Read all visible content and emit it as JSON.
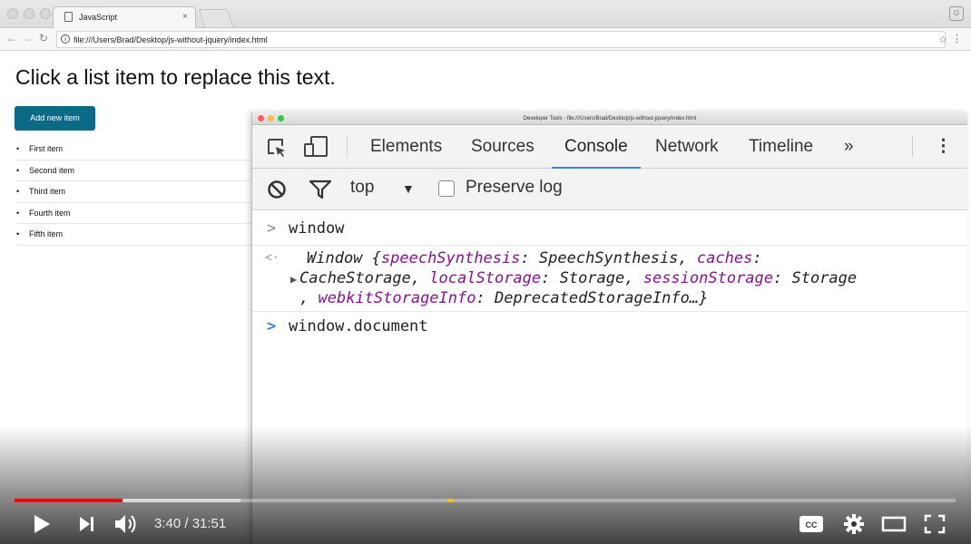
{
  "browser": {
    "tab_title": "JavaScript",
    "tab_close": "×",
    "url": "file:///Users/Brad/Desktop/js-without-jquery/index.html"
  },
  "page": {
    "heading": "Click a list item to replace this text.",
    "add_button": "Add new item",
    "items": [
      "First item",
      "Second item",
      "Third item",
      "Fourth item",
      "Fifth item"
    ]
  },
  "devtools": {
    "window_title": "Developer Tools - file:///Users/Brad/Desktop/js-without-jquery/index.html",
    "tabs": [
      "Elements",
      "Sources",
      "Console",
      "Network",
      "Timeline"
    ],
    "active_tab": "Console",
    "more_tabs": "»",
    "context": "top",
    "preserve_log": "Preserve log",
    "console": {
      "input1": "window",
      "output1": {
        "line1_a": "Window {",
        "line1_b": "speechSynthesis",
        "line1_c": ": SpeechSynthesis, ",
        "line1_d": "caches",
        "line1_e": ":",
        "line2_a": "CacheStorage, ",
        "line2_b": "localStorage",
        "line2_c": ": Storage, ",
        "line2_d": "sessionStorage",
        "line2_e": ": Storage",
        "line3_a": ", ",
        "line3_b": "webkitStorageInfo",
        "line3_c": ": DeprecatedStorageInfo…}"
      },
      "input2": "window.document"
    }
  },
  "player": {
    "time": "3:40 / 31:51",
    "played_fraction": 0.115,
    "buffered_fraction": 0.24,
    "accent": "#ff0000"
  }
}
